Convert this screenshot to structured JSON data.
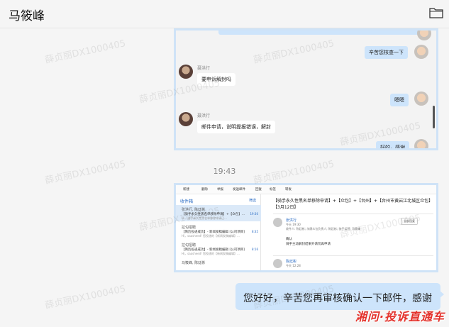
{
  "header": {
    "title": "马筱峰"
  },
  "watermark_text": "薛贞丽DX1000405",
  "chat_shot": {
    "messages": [
      {
        "side": "right",
        "text": "辛苦您核查一下"
      },
      {
        "side": "left",
        "sender": "聂洪行",
        "text": "要申诉解封吗"
      },
      {
        "side": "right",
        "text": "嗯嗯"
      },
      {
        "side": "left",
        "sender": "聂洪行",
        "text": "邮件申请，说明提报错误，解封"
      },
      {
        "side": "right",
        "text": "好的，感谢"
      }
    ]
  },
  "timestamp": "19:43",
  "mail_shot": {
    "toolbar": [
      "新建",
      "删除",
      "举报",
      "发送邮件",
      "回复",
      "标签",
      "转发"
    ],
    "inbox_title": "收件箱",
    "filter_label": "筛选",
    "mails": [
      {
        "name": "张洪行, 陈廷彬",
        "subject": "【骑手永久性黑名单移除申请】+【众包】...",
        "preview": "Hi，骑手永久性黑名单移除申请已...",
        "time": "19:30",
        "selected": true
      },
      {
        "name": "拉勾招聘",
        "subject": "【简历投递成功】- 新闻发稿编辑 [公司项目]",
        "preview": "Hi，saasheed! 您投递的【新闻发稿编辑】...",
        "time": "8:35",
        "selected": false
      },
      {
        "name": "拉勾招聘",
        "subject": "【简历投递成功】- 新闻发稿编辑 [公司项目]",
        "preview": "Hi，saasheed! 您投递的【新闻发稿编辑】...",
        "time": "8:16",
        "selected": false
      },
      {
        "name": "马筱峰, 陈廷彬",
        "subject": "",
        "preview": "",
        "time": "",
        "selected": false
      }
    ],
    "reading": {
      "subject": "【骑手永久性黑名单移除申请】+【众包】+【台州】+【台州市黄岩江北城区众包】【3月12日】",
      "sender1": "张洪行",
      "meta1": "今天 19:30",
      "recipients": "收件人: 陈廷彬; 永康众包负责人; 陈廷彬; 骑手运营; 马筱峰",
      "reply_all": "全部回复",
      "body_line1": "确认",
      "body_line2": "骑手主动解封结果外请勿再申请",
      "sender2": "陈廷彬",
      "meta2": "今天 12:28"
    }
  },
  "outgoing": {
    "text": "您好好，辛苦您再审核确认一下邮件，感谢"
  },
  "brand_text": "湘问·投诉直通车"
}
